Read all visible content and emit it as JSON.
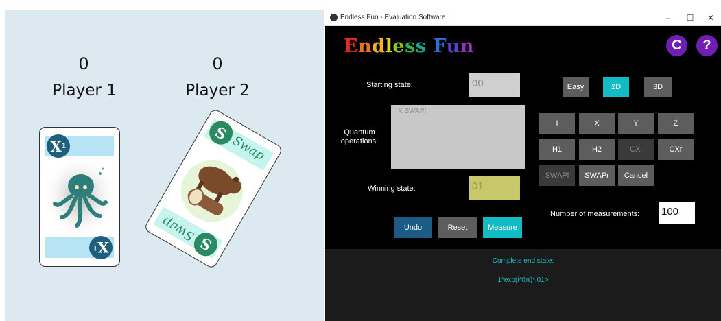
{
  "game": {
    "player1": {
      "score": "0",
      "name": "Player 1",
      "card": {
        "badge": "X",
        "badge_sub": "1",
        "theme": "octopus",
        "band_color": "#b6e4f4"
      }
    },
    "player2": {
      "score": "0",
      "name": "Player 2",
      "card": {
        "badge": "S",
        "title": "Swap",
        "theme": "bear",
        "band_color": "#c6f4ee"
      }
    },
    "background": "#dde9f0"
  },
  "window": {
    "title": "Endless Fun - Evaluation Software",
    "controls": {
      "minimize": "–",
      "maximize": "☐",
      "close": "✕"
    }
  },
  "app": {
    "title_letters": [
      {
        "ch": "E",
        "color": "#e62a1c"
      },
      {
        "ch": "n",
        "color": "#f0731c"
      },
      {
        "ch": "d",
        "color": "#f6b21f"
      },
      {
        "ch": "l",
        "color": "#e8d21e"
      },
      {
        "ch": "e",
        "color": "#8cc524"
      },
      {
        "ch": "s",
        "color": "#2fb34a"
      },
      {
        "ch": "s",
        "color": "#1ca58f"
      },
      {
        "ch": " ",
        "color": "#000000"
      },
      {
        "ch": "F",
        "color": "#2d6fd6"
      },
      {
        "ch": "u",
        "color": "#5a3fd0"
      },
      {
        "ch": "n",
        "color": "#9a2fc0"
      }
    ],
    "credits_button": "C",
    "help_button": "?",
    "starting_state": {
      "label": "Starting state:",
      "value": "00"
    },
    "quantum_ops": {
      "label": "Quantum operations:",
      "value": "X SWAPI"
    },
    "winning_state": {
      "label": "Winning state:",
      "value": "01"
    },
    "difficulty": {
      "easy": "Easy",
      "two_d": "2D",
      "three_d": "3D"
    },
    "gates": [
      "I",
      "X",
      "Y",
      "Z",
      "H1",
      "H2",
      "CXl",
      "CXr",
      "SWAPl",
      "SWAPr",
      "Cancel"
    ],
    "measurements": {
      "label": "Number of measurements:",
      "value": "100"
    },
    "actions": {
      "undo": "Undo",
      "reset": "Reset",
      "measure": "Measure"
    },
    "end_state": {
      "label": "Complete end state:",
      "value": "1*exp(i*0π)*|01>"
    }
  },
  "colors": {
    "accent": "#11bcc4",
    "navy": "#1c5b85",
    "purple": "#6f1fb5",
    "gray_button": "#5d5d5d",
    "starting_field": "#cfcfcf",
    "winning_field": "#c8c86a"
  }
}
